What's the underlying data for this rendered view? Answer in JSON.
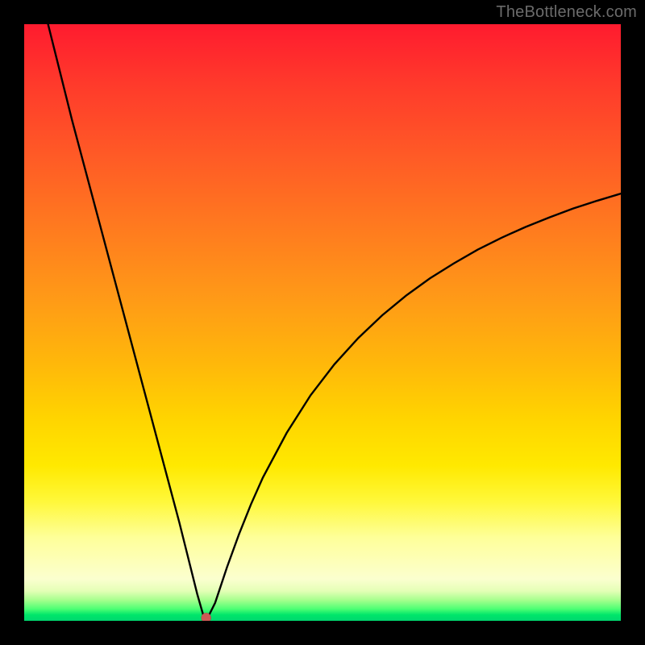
{
  "watermark": "TheBottleneck.com",
  "colors": {
    "background": "#000000",
    "gradient_top": "#ff1b2f",
    "gradient_bottom": "#00d66e",
    "curve_stroke": "#000000",
    "dot_fill": "#cc5a55"
  },
  "chart_data": {
    "type": "line",
    "title": "",
    "xlabel": "",
    "ylabel": "",
    "xlim": [
      0,
      100
    ],
    "ylim": [
      0,
      100
    ],
    "comment": "Curve resembles bottleneck magnitude: a steep drop from upper-left to a minimum near x≈30, then a concave rise toward x=100, y≈72. Values are visually estimated from pixel positions.",
    "series": [
      {
        "name": "bottleneck-curve",
        "x": [
          4,
          6,
          8,
          10,
          12,
          14,
          16,
          18,
          20,
          22,
          24,
          26,
          27,
          28,
          29,
          30,
          31,
          32,
          34,
          36,
          38,
          40,
          44,
          48,
          52,
          56,
          60,
          64,
          68,
          72,
          76,
          80,
          84,
          88,
          92,
          96,
          100
        ],
        "values": [
          100,
          92,
          84,
          76.5,
          69,
          61.5,
          54,
          46.5,
          39,
          31.5,
          24,
          16.5,
          12.5,
          8.5,
          4.5,
          1.0,
          1.0,
          3.0,
          9.0,
          14.5,
          19.5,
          24.0,
          31.5,
          37.8,
          43.0,
          47.4,
          51.2,
          54.5,
          57.4,
          59.9,
          62.2,
          64.2,
          66.0,
          67.6,
          69.1,
          70.4,
          71.6
        ]
      }
    ],
    "annotations": [
      {
        "name": "min-dot",
        "x": 30.5,
        "y": 0.5
      }
    ]
  }
}
